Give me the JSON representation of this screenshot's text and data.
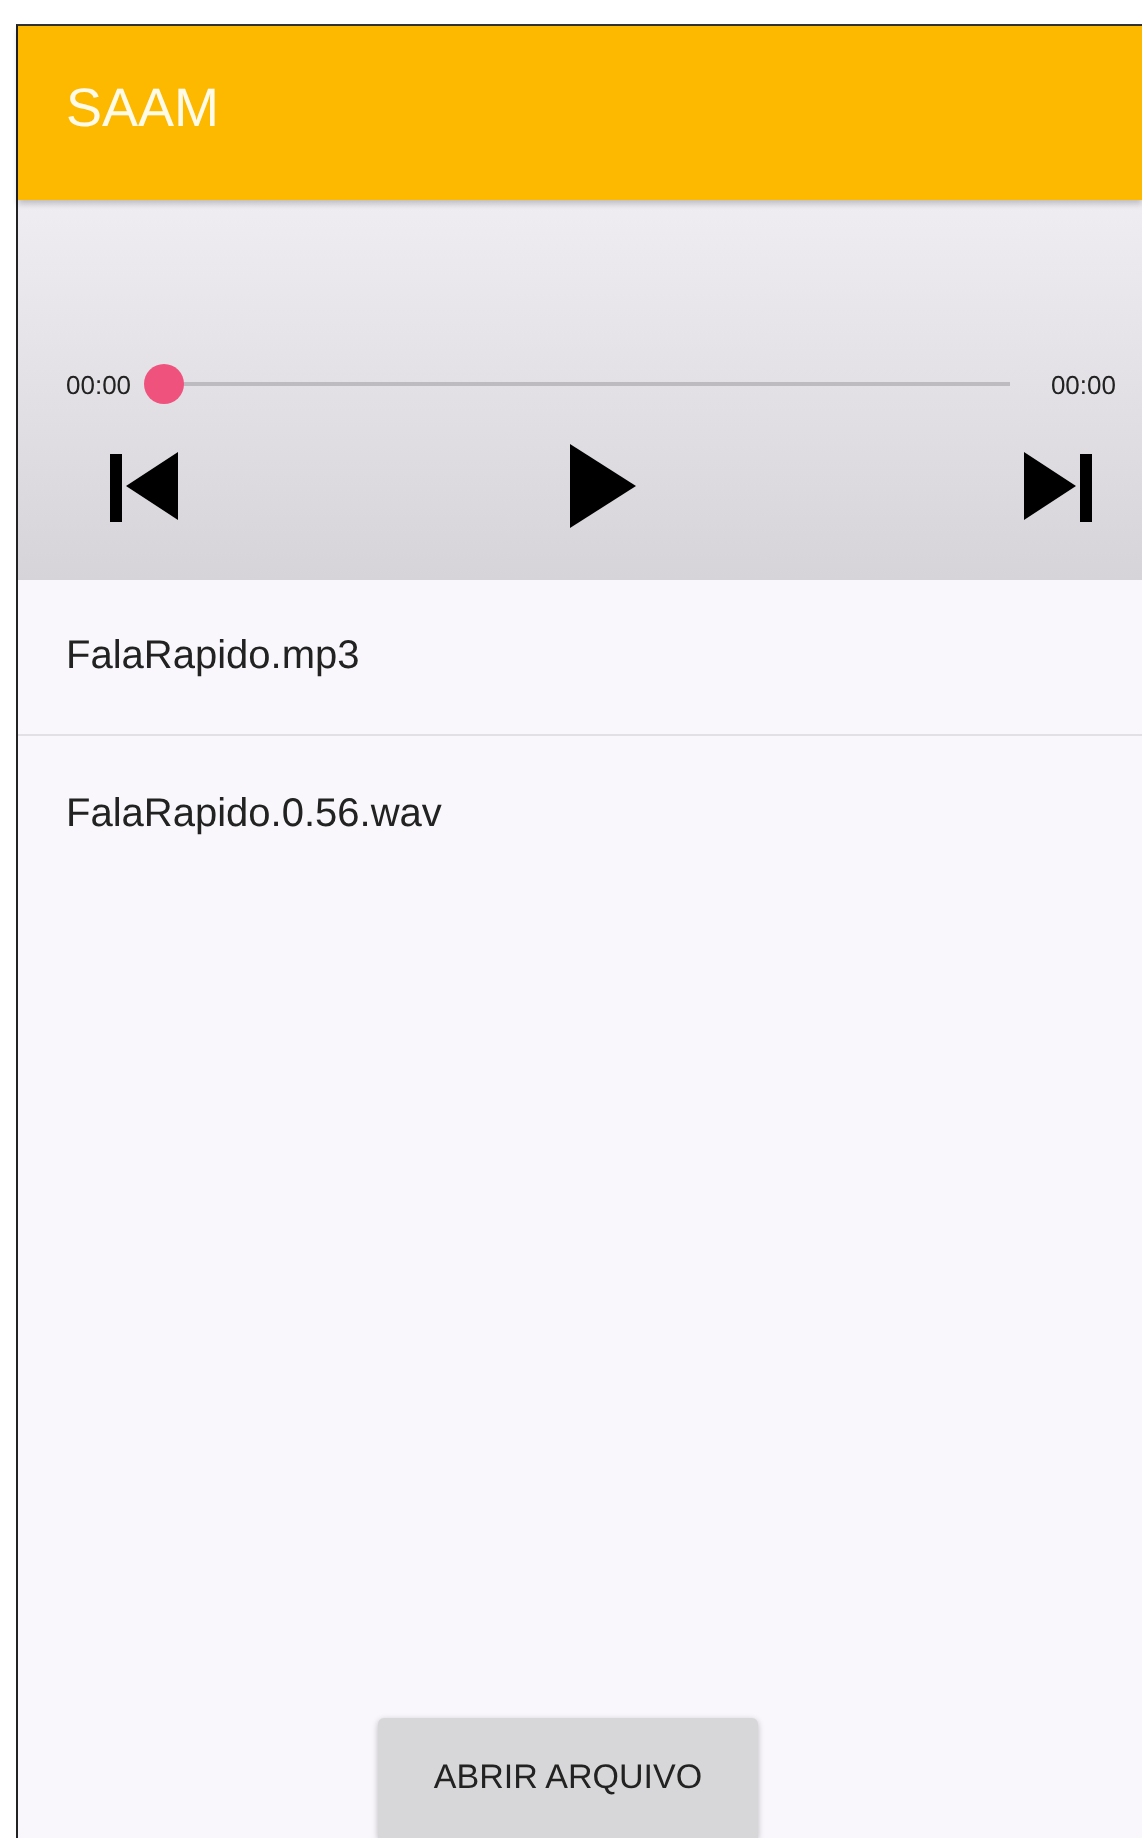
{
  "app_bar": {
    "title": "SAAM"
  },
  "player": {
    "elapsed": "00:00",
    "duration": "00:00",
    "level": 0
  },
  "files": [
    {
      "name": "FalaRapido.mp3"
    },
    {
      "name": "FalaRapido.0.56.wav"
    }
  ],
  "open_button": {
    "label": "ABRIR ARQUIVO"
  }
}
